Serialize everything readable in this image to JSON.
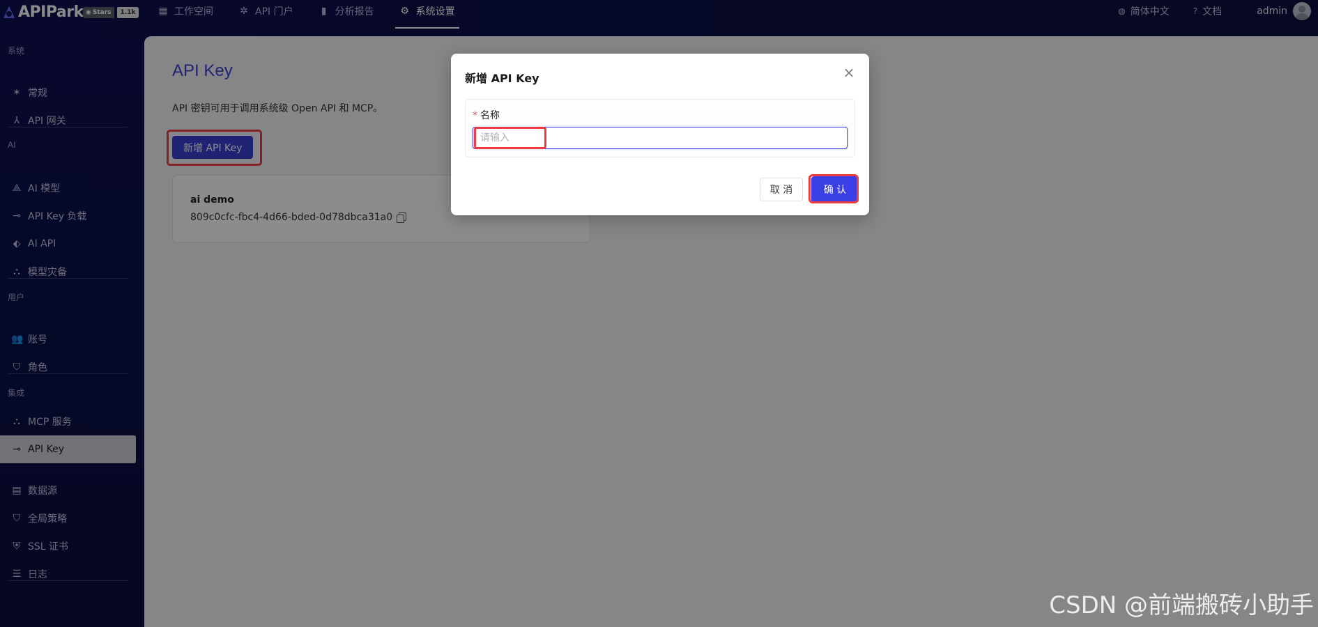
{
  "app": {
    "logo_text": "APIPark",
    "stars_label": "Stars",
    "stars_count": "1.1k"
  },
  "topnav": {
    "items": [
      {
        "label": "工作空间",
        "icon": "dashboard-icon"
      },
      {
        "label": "API 门户",
        "icon": "network-icon"
      },
      {
        "label": "分析报告",
        "icon": "bar-chart-icon"
      },
      {
        "label": "系统设置",
        "icon": "gear-icon"
      }
    ],
    "active": "系统设置",
    "language": "简体中文",
    "docs": "文档",
    "user": "admin"
  },
  "sidebar": {
    "groups": [
      {
        "label": "系统",
        "items": [
          {
            "label": "常规"
          },
          {
            "label": "API 网关"
          }
        ]
      },
      {
        "label": "AI",
        "items": [
          {
            "label": "AI 模型"
          },
          {
            "label": "API Key 负载"
          },
          {
            "label": "AI API"
          },
          {
            "label": "模型灾备"
          }
        ]
      },
      {
        "label": "用户",
        "items": [
          {
            "label": "账号"
          },
          {
            "label": "角色"
          }
        ]
      },
      {
        "label": "集成",
        "items": [
          {
            "label": "MCP 服务"
          },
          {
            "label": "API Key"
          },
          {
            "label": "数据源"
          },
          {
            "label": "全局策略"
          },
          {
            "label": "SSL 证书"
          },
          {
            "label": "日志"
          }
        ]
      }
    ],
    "active": "API Key"
  },
  "main": {
    "title": "API Key",
    "description": "API 密钥可用于调用系统级 Open API 和 MCP。",
    "add_button": "新增 API Key",
    "keys": [
      {
        "name": "ai demo",
        "value": "809c0cfc-fbc4-4d66-bded-0d78dbca31a0"
      }
    ]
  },
  "modal": {
    "title": "新增 API Key",
    "field_label": "名称",
    "field_placeholder": "请输入",
    "field_value": "",
    "cancel": "取 消",
    "confirm": "确 认"
  },
  "watermark": "CSDN @前端搬砖小助手",
  "colors": {
    "primary": "#3b3fd3",
    "highlight": "#ef3b3f",
    "sidebar_bg": "#0d1050"
  }
}
